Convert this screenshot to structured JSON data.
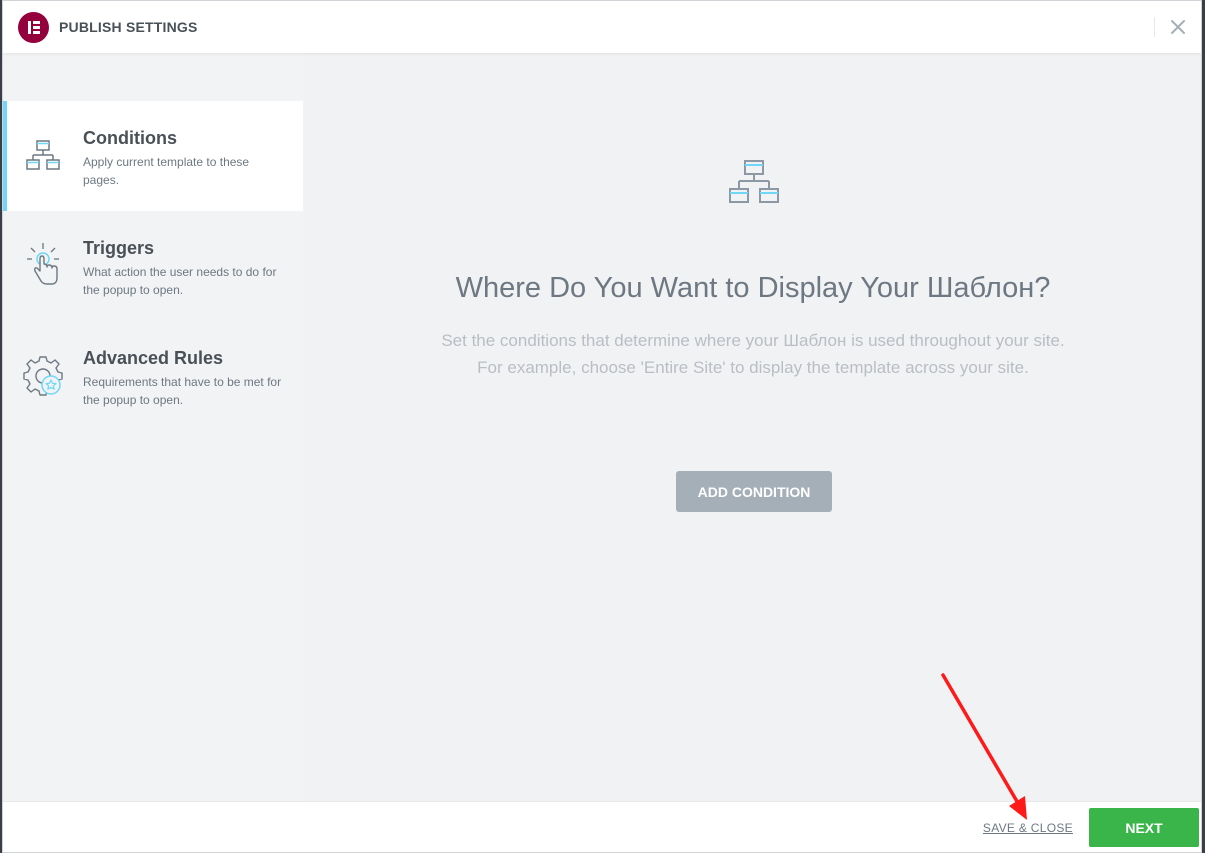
{
  "header": {
    "title": "PUBLISH SETTINGS",
    "logo_icon": "elementor-logo-icon",
    "close_icon": "close-icon"
  },
  "sidebar": {
    "items": [
      {
        "title": "Conditions",
        "description": "Apply current template to these pages.",
        "icon": "sitemap-icon",
        "active": true
      },
      {
        "title": "Triggers",
        "description": "What action the user needs to do for the popup to open.",
        "icon": "hand-click-icon",
        "active": false
      },
      {
        "title": "Advanced Rules",
        "description": "Requirements that have to be met for the popup to open.",
        "icon": "gear-star-icon",
        "active": false
      }
    ]
  },
  "main": {
    "icon": "sitemap-icon",
    "title": "Where Do You Want to Display Your Шаблон?",
    "description_line1": "Set the conditions that determine where your Шаблон is used throughout your site.",
    "description_line2": "For example, choose 'Entire Site' to display the template across your site.",
    "add_button": "ADD CONDITION"
  },
  "footer": {
    "save_close": "SAVE & CLOSE",
    "next": "NEXT"
  },
  "colors": {
    "brand": "#93003c",
    "accent": "#71d7f7",
    "primary_button": "#39b54a",
    "secondary_button": "#a4afb7",
    "annotation_arrow": "#ff1a1a"
  }
}
